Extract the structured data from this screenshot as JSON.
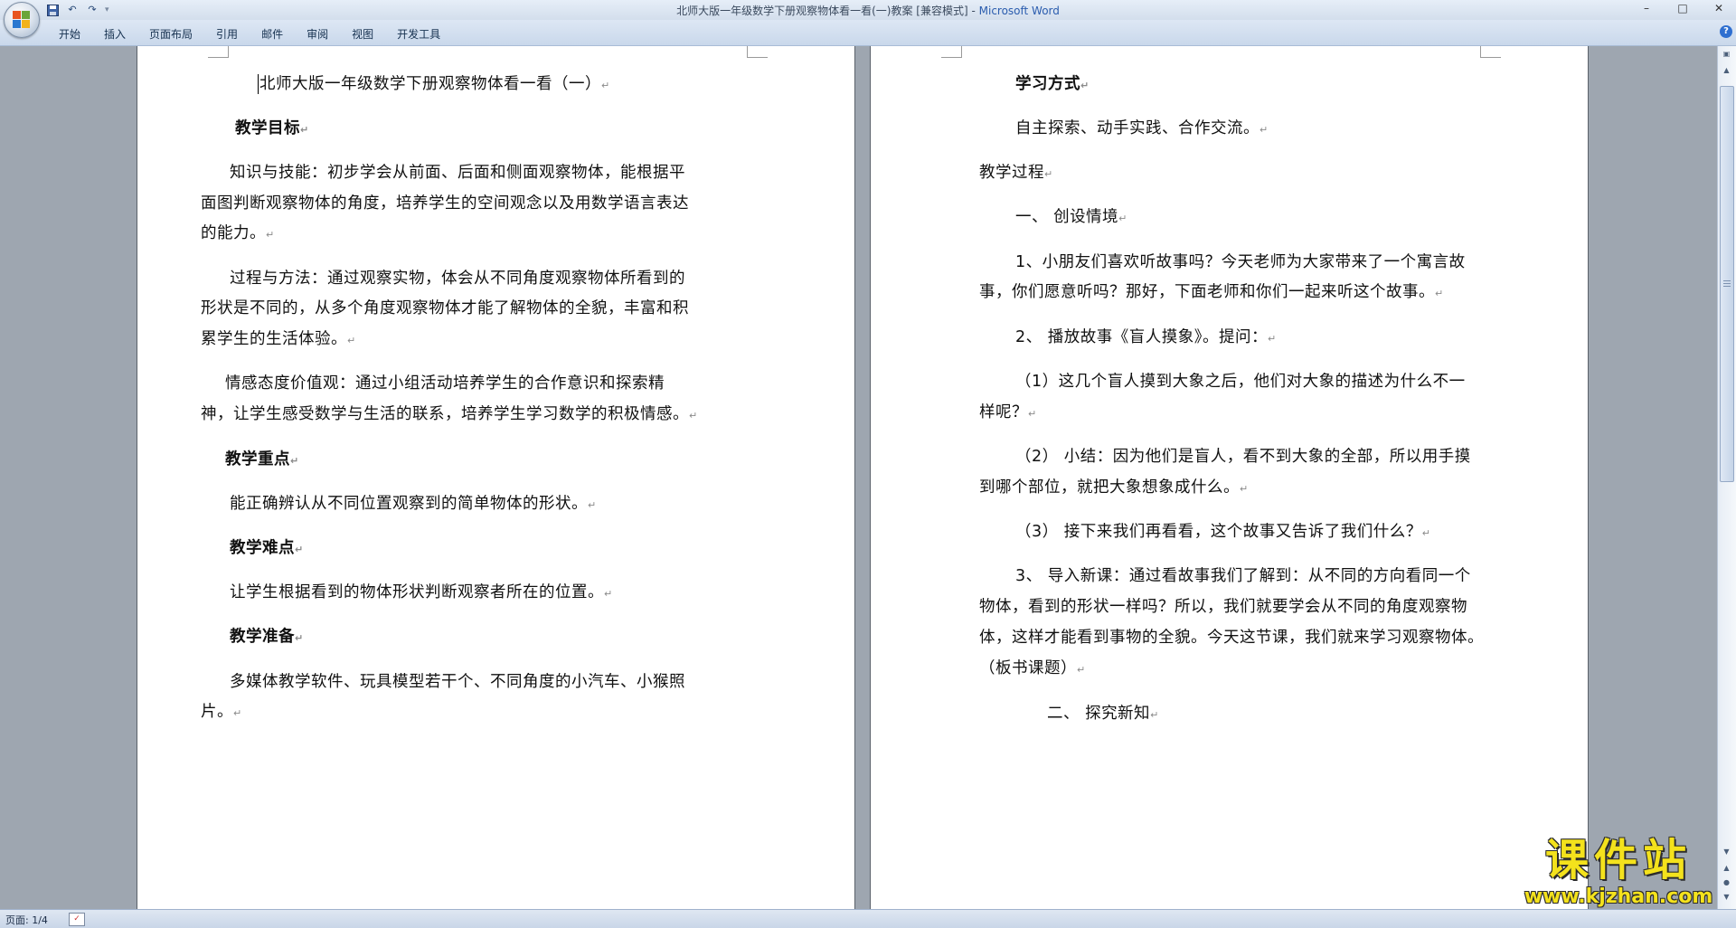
{
  "window": {
    "title": "北师大版一年级数学下册观察物体看一看(一)教案 [兼容模式] -",
    "app_name": "Microsoft Word",
    "controls": {
      "minimize": "–",
      "maximize": "□",
      "close": "✕"
    }
  },
  "quick_access": {
    "save": "save-icon",
    "undo": "↶",
    "redo": "↷",
    "more": "▾"
  },
  "ribbon": {
    "tabs": [
      "开始",
      "插入",
      "页面布局",
      "引用",
      "邮件",
      "审阅",
      "视图",
      "开发工具"
    ],
    "help": "?"
  },
  "document": {
    "left_page": [
      "北师大版一年级数学下册观察物体看一看（一）",
      "教学目标",
      "知识与技能：初步学会从前面、后面和侧面观察物体，能根据平",
      "面图判断观察物体的角度，培养学生的空间观念以及用数学语言表达",
      "的能力。",
      "过程与方法：通过观察实物，体会从不同角度观察物体所看到的",
      "形状是不同的，从多个角度观察物体才能了解物体的全貌，丰富和积",
      "累学生的生活体验。",
      "情感态度价值观：通过小组活动培养学生的合作意识和探索精",
      "神，让学生感受数学与生活的联系，培养学生学习数学的积极情感。",
      "教学重点",
      "能正确辨认从不同位置观察到的简单物体的形状。",
      "教学难点",
      "让学生根据看到的物体形状判断观察者所在的位置。",
      "教学准备",
      "多媒体教学软件、玩具模型若干个、不同角度的小汽车、小猴照",
      "片。"
    ],
    "right_page": [
      "学习方式",
      "自主探索、动手实践、合作交流。",
      "教学过程",
      "一、 创设情境",
      "1、小朋友们喜欢听故事吗？今天老师为大家带来了一个寓言故",
      "事，你们愿意听吗？那好，下面老师和你们一起来听这个故事。",
      "2、 播放故事《盲人摸象》。提问：",
      "（1）这几个盲人摸到大象之后，他们对大象的描述为什么不一",
      "样呢？",
      "（2） 小结：因为他们是盲人，看不到大象的全部，所以用手摸",
      "到哪个部位，就把大象想象成什么。",
      "（3） 接下来我们再看看，这个故事又告诉了我们什么？",
      "3、 导入新课：通过看故事我们了解到：从不同的方向看同一个",
      "物体，看到的形状一样吗？所以，我们就要学会从不同的角度观察物",
      "体，这样才能看到事物的全貌。今天这节课，我们就来学习观察物体。",
      "（板书课题）",
      "二、 探究新知"
    ],
    "paragraph_mark": "↵"
  },
  "statusbar": {
    "page": "页面: 1/4"
  },
  "watermark": {
    "title": "课件站",
    "url": "www.kjzhan.com"
  }
}
